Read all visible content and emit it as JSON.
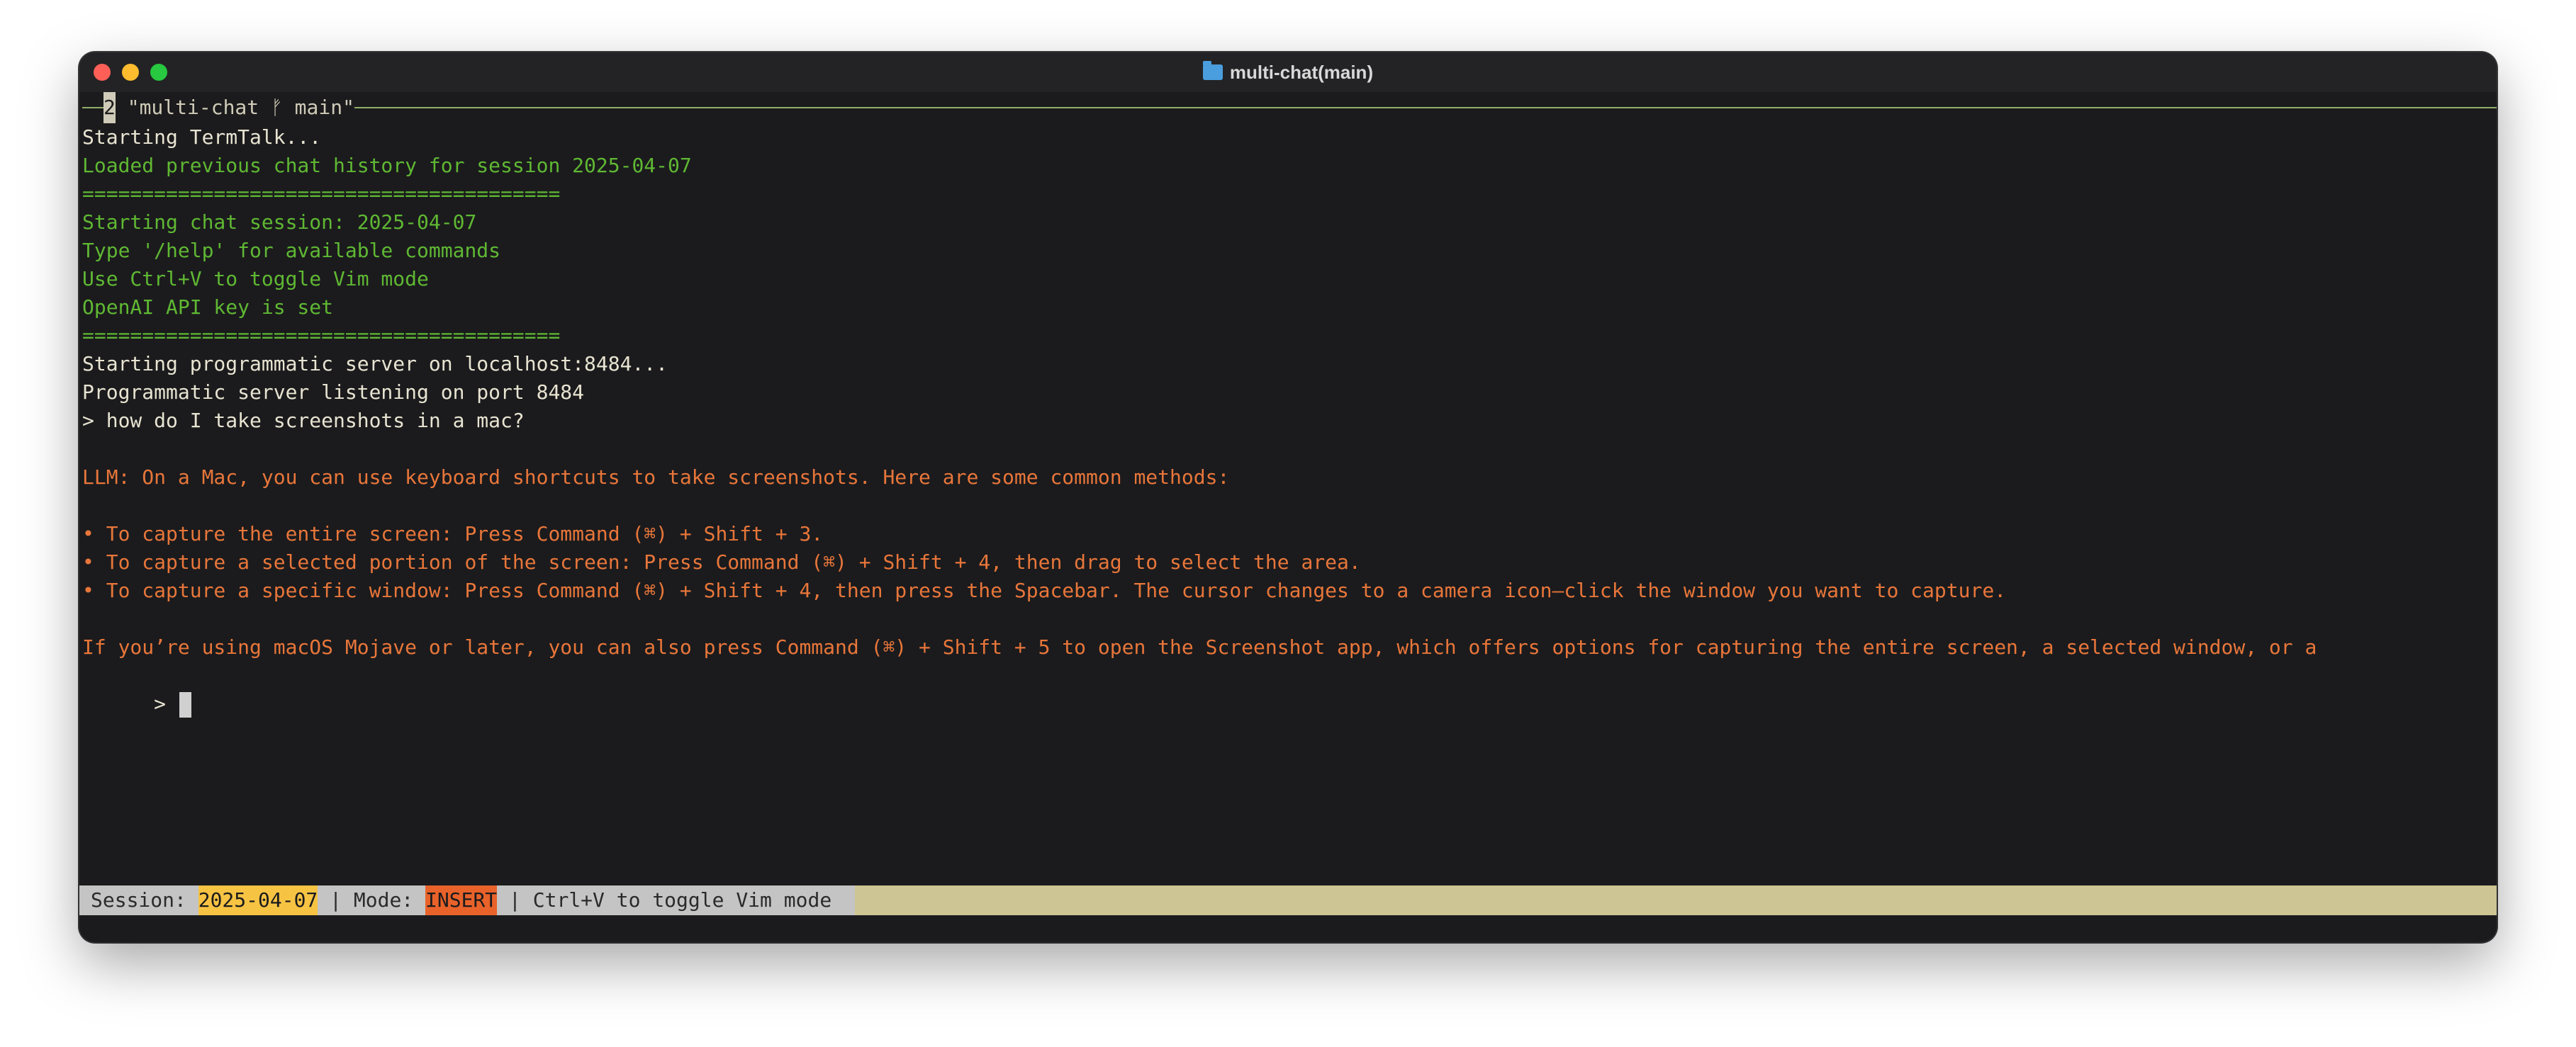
{
  "window": {
    "title": "multi-chat(main)",
    "title_icon": "folder-icon"
  },
  "pane": {
    "number": "2",
    "label": " \"multi-chat ᚠ main\""
  },
  "terminal": {
    "lines": [
      {
        "text": "Starting TermTalk...",
        "color": "#e8e4d2"
      },
      {
        "text": "Loaded previous chat history for session 2025-04-07",
        "color": "#5fb833"
      },
      {
        "text": "========================================",
        "color": "#5fb833"
      },
      {
        "text": "Starting chat session: 2025-04-07",
        "color": "#5fb833"
      },
      {
        "text": "Type '/help' for available commands",
        "color": "#5fb833"
      },
      {
        "text": "Use Ctrl+V to toggle Vim mode",
        "color": "#5fb833"
      },
      {
        "text": "OpenAI API key is set",
        "color": "#5fb833"
      },
      {
        "text": "========================================",
        "color": "#5fb833"
      },
      {
        "text": "Starting programmatic server on localhost:8484...",
        "color": "#e8e4d2"
      },
      {
        "text": "Programmatic server listening on port 8484",
        "color": "#e8e4d2"
      },
      {
        "text": "> how do I take screenshots in a mac?",
        "color": "#e8e4d2"
      },
      {
        "text": "",
        "color": "#e8e4d2"
      },
      {
        "text": "LLM: On a Mac, you can use keyboard shortcuts to take screenshots. Here are some common methods:",
        "color": "#e8763a"
      },
      {
        "text": "",
        "color": "#e8763a"
      },
      {
        "text": "• To capture the entire screen: Press Command (⌘) + Shift + 3.",
        "color": "#e8763a"
      },
      {
        "text": "• To capture a selected portion of the screen: Press Command (⌘) + Shift + 4, then drag to select the area.",
        "color": "#e8763a"
      },
      {
        "text": "• To capture a specific window: Press Command (⌘) + Shift + 4, then press the Spacebar. The cursor changes to a camera icon—click the window you want to capture.",
        "color": "#e8763a"
      },
      {
        "text": "",
        "color": "#e8763a"
      },
      {
        "text": "If you’re using macOS Mojave or later, you can also press Command (⌘) + Shift + 5 to open the Screenshot app, which offers options for capturing the entire screen, a selected window, or a",
        "color": "#e8763a"
      }
    ],
    "prompt": ">"
  },
  "status": {
    "session_label": "Session: ",
    "session_value": "2025-04-07",
    "sep1": " | Mode: ",
    "mode_value": "INSERT",
    "sep2": " | Ctrl+V to toggle Vim mode "
  },
  "colors": {
    "background": "#1b1b1d",
    "status_bar": "#cdc593",
    "session_highlight": "#f6c343",
    "mode_highlight": "#e8622a"
  }
}
